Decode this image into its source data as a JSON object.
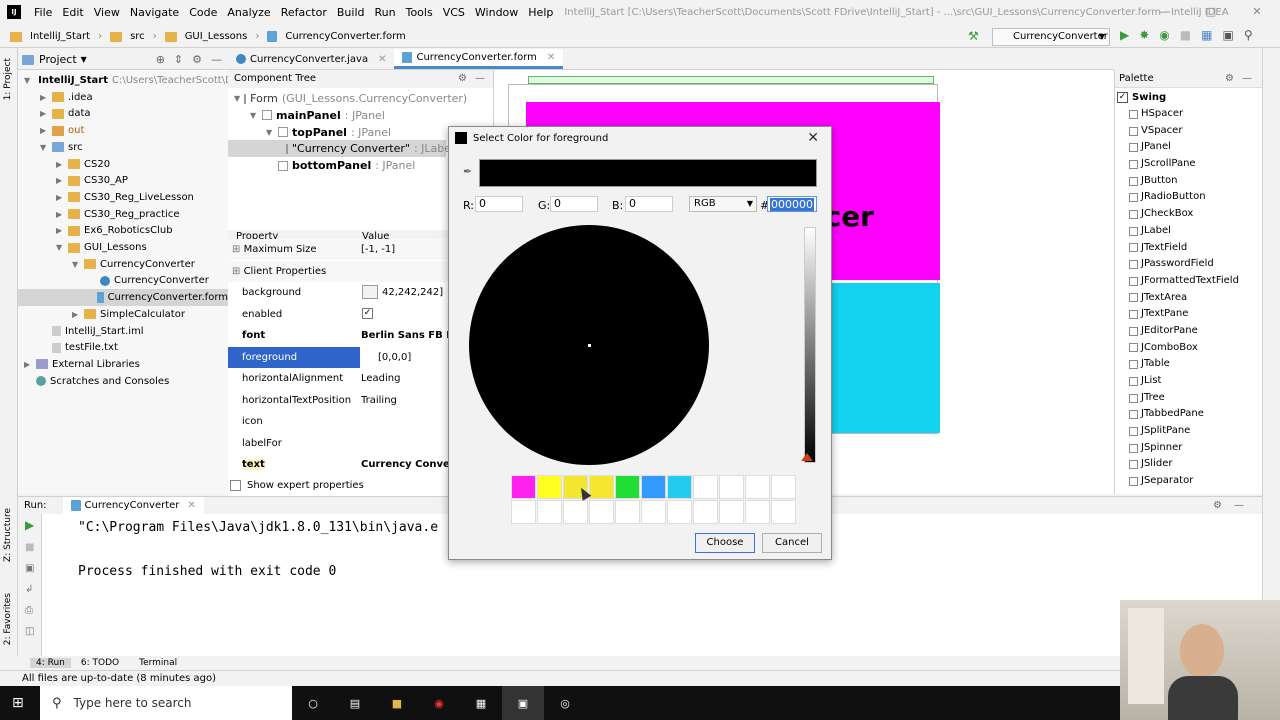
{
  "window": {
    "menu": [
      "File",
      "Edit",
      "View",
      "Navigate",
      "Code",
      "Analyze",
      "Refactor",
      "Build",
      "Run",
      "Tools",
      "VCS",
      "Window",
      "Help"
    ],
    "title": "IntelliJ_Start [C:\\Users\\TeacherScott\\Documents\\Scott FDrive\\IntelliJ_Start] - ...\\src\\GUI_Lessons\\CurrencyConverter.form - IntelliJ IDEA"
  },
  "navbar": {
    "crumbs": [
      "IntelliJ_Start",
      "src",
      "GUI_Lessons",
      "CurrencyConverter.form"
    ],
    "run_config": "CurrencyConverter"
  },
  "project": {
    "header": "Project",
    "tree": [
      {
        "label": "IntelliJ_Start",
        "extra": "C:\\Users\\TeacherScott\\Dc",
        "indent": 0,
        "type": "folder",
        "open": true,
        "bold": true
      },
      {
        "label": ".idea",
        "indent": 1,
        "type": "folder"
      },
      {
        "label": "data",
        "indent": 1,
        "type": "folder"
      },
      {
        "label": "out",
        "indent": 1,
        "type": "folder-orange"
      },
      {
        "label": "src",
        "indent": 1,
        "type": "folder-blue",
        "open": true
      },
      {
        "label": "CS20",
        "indent": 2,
        "type": "folder"
      },
      {
        "label": "CS30_AP",
        "indent": 2,
        "type": "folder"
      },
      {
        "label": "CS30_Reg_LiveLesson",
        "indent": 2,
        "type": "folder"
      },
      {
        "label": "CS30_Reg_practice",
        "indent": 2,
        "type": "folder"
      },
      {
        "label": "Ex6_RoboticsClub",
        "indent": 2,
        "type": "folder"
      },
      {
        "label": "GUI_Lessons",
        "indent": 2,
        "type": "folder",
        "open": true
      },
      {
        "label": "CurrencyConverter",
        "indent": 3,
        "type": "folder",
        "open": true
      },
      {
        "label": "CurrencyConverter",
        "indent": 4,
        "type": "java"
      },
      {
        "label": "CurrencyConverter.form",
        "indent": 4,
        "type": "form",
        "selected": true
      },
      {
        "label": "SimpleCalculator",
        "indent": 3,
        "type": "folder"
      },
      {
        "label": "IntelliJ_Start.iml",
        "indent": 1,
        "type": "file"
      },
      {
        "label": "testFile.txt",
        "indent": 1,
        "type": "file"
      },
      {
        "label": "External Libraries",
        "indent": 0,
        "type": "lib"
      },
      {
        "label": "Scratches and Consoles",
        "indent": 0,
        "type": "scratch"
      }
    ]
  },
  "editor_tabs": [
    {
      "label": "CurrencyConverter.java",
      "active": false
    },
    {
      "label": "CurrencyConverter.form",
      "active": true
    }
  ],
  "component_tree": {
    "header": "Component Tree",
    "nodes": [
      {
        "label": "Form",
        "sub": "(GUI_Lessons.CurrencyConverter)",
        "indent": 0
      },
      {
        "label": "mainPanel",
        "sub": ": JPanel",
        "indent": 1,
        "bold": true
      },
      {
        "label": "topPanel",
        "sub": ": JPanel",
        "indent": 2,
        "bold": true
      },
      {
        "label": "\"Currency Converter\"",
        "sub": ": JLabel",
        "indent": 3,
        "selected": true
      },
      {
        "label": "bottomPanel",
        "sub": ": JPanel",
        "indent": 2,
        "bold": true
      }
    ]
  },
  "properties": {
    "header_property": "Property",
    "header_value": "Value",
    "rows": [
      {
        "k": "Maximum Size",
        "v": "[-1, -1]",
        "group": true
      },
      {
        "k": "Client Properties",
        "v": "",
        "group": true
      },
      {
        "k": "background",
        "v": "42,242,242]",
        "swatch": true
      },
      {
        "k": "enabled",
        "v": "",
        "check": true
      },
      {
        "k": "font",
        "v": "Berlin Sans FB Den",
        "bold": true
      },
      {
        "k": "foreground",
        "v": "[0,0,0]",
        "selected": true
      },
      {
        "k": "horizontalAlignment",
        "v": "Leading"
      },
      {
        "k": "horizontalTextPosition",
        "v": "Trailing"
      },
      {
        "k": "icon",
        "v": ""
      },
      {
        "k": "labelFor",
        "v": ""
      },
      {
        "k": "text",
        "v": "Currency Converte",
        "bold": true,
        "highlight": true
      }
    ],
    "show_expert": "Show expert properties"
  },
  "canvas": {
    "label_text": "cer",
    "top_color": "#ff00ff",
    "bottom_color": "#14d2f0"
  },
  "palette": {
    "header": "Palette",
    "group": "Swing",
    "items": [
      "HSpacer",
      "VSpacer",
      "JPanel",
      "JScrollPane",
      "JButton",
      "JRadioButton",
      "JCheckBox",
      "JLabel",
      "JTextField",
      "JPasswordField",
      "JFormattedTextField",
      "JTextArea",
      "JTextPane",
      "JEditorPane",
      "JComboBox",
      "JTable",
      "JList",
      "JTree",
      "JTabbedPane",
      "JSplitPane",
      "JSpinner",
      "JSlider",
      "JSeparator"
    ]
  },
  "run": {
    "label": "Run:",
    "tab": "CurrencyConverter",
    "lines": [
      "\"C:\\Program Files\\Java\\jdk1.8.0_131\\bin\\java.e",
      "",
      "Process finished with exit code 0"
    ]
  },
  "bottom_tools": [
    "4: Run",
    "6: TODO",
    "Terminal"
  ],
  "status": "All files are up-to-date (8 minutes ago)",
  "taskbar": {
    "search_placeholder": "Type here to search"
  },
  "dialog": {
    "title": "Select Color for foreground",
    "r_label": "R:",
    "r_value": "0",
    "g_label": "G:",
    "g_value": "0",
    "b_label": "B:",
    "b_value": "0",
    "mode": "RGB",
    "hash": "#",
    "hex": "000000",
    "preview_color": "#000000",
    "recent_colors": [
      "#ff22ee",
      "#ffff22",
      "#f2e62e",
      "#f5e62e",
      "#22dd33",
      "#3399ff",
      "#22ccee",
      "",
      "",
      "",
      "",
      "",
      "",
      "",
      "",
      "",
      "",
      "",
      "",
      "",
      "",
      ""
    ],
    "choose": "Choose",
    "cancel": "Cancel"
  }
}
